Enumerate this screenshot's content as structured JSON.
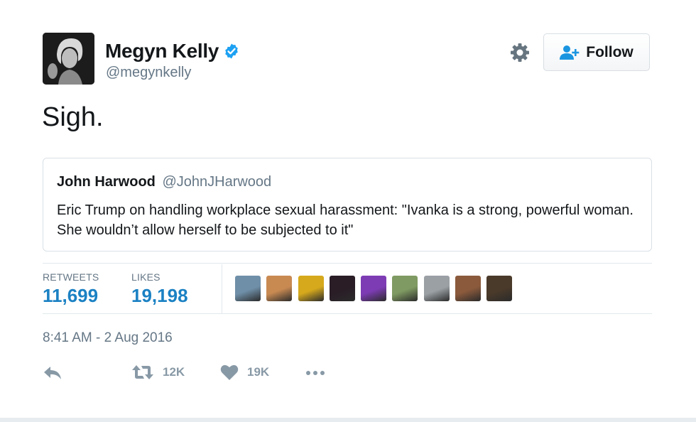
{
  "author": {
    "display_name": "Megyn Kelly",
    "handle": "@megynkelly",
    "verified_icon": "verified-badge-icon",
    "avatar_icon": "author-avatar"
  },
  "header": {
    "settings_icon": "gear-icon",
    "follow_label": "Follow",
    "follow_icon": "add-user-icon"
  },
  "tweet": {
    "text": "Sigh.",
    "timestamp": "8:41 AM - 2 Aug 2016"
  },
  "quoted_tweet": {
    "name": "John Harwood",
    "handle": "@JohnJHarwood",
    "text": "Eric Trump on handling workplace sexual harassment: \"Ivanka is a strong, powerful woman. She wouldn’t allow herself to be subjected to it\""
  },
  "stats": {
    "retweets_label": "RETWEETS",
    "retweets_value": "11,699",
    "likes_label": "LIKES",
    "likes_value": "19,198"
  },
  "likers": [
    {
      "name": "liker-avatar-1",
      "color": "#6f8fa8"
    },
    {
      "name": "liker-avatar-2",
      "color": "#c98a52"
    },
    {
      "name": "liker-avatar-3",
      "color": "#d6a91c"
    },
    {
      "name": "liker-avatar-4",
      "color": "#2a1d26"
    },
    {
      "name": "liker-avatar-5",
      "color": "#7d3cb4"
    },
    {
      "name": "liker-avatar-6",
      "color": "#7f9a62"
    },
    {
      "name": "liker-avatar-7",
      "color": "#9aa0a4"
    },
    {
      "name": "liker-avatar-8",
      "color": "#8b5a3c"
    },
    {
      "name": "liker-avatar-9",
      "color": "#4a3a2a"
    }
  ],
  "actions": {
    "reply_icon": "reply-icon",
    "retweet_icon": "retweet-icon",
    "retweet_count": "12K",
    "like_icon": "heart-icon",
    "like_count": "19K",
    "more_icon": "more-icon"
  },
  "colors": {
    "accent": "#1b81c3",
    "verified": "#1da1f2",
    "muted": "#657786",
    "border": "#e1e8ed"
  }
}
